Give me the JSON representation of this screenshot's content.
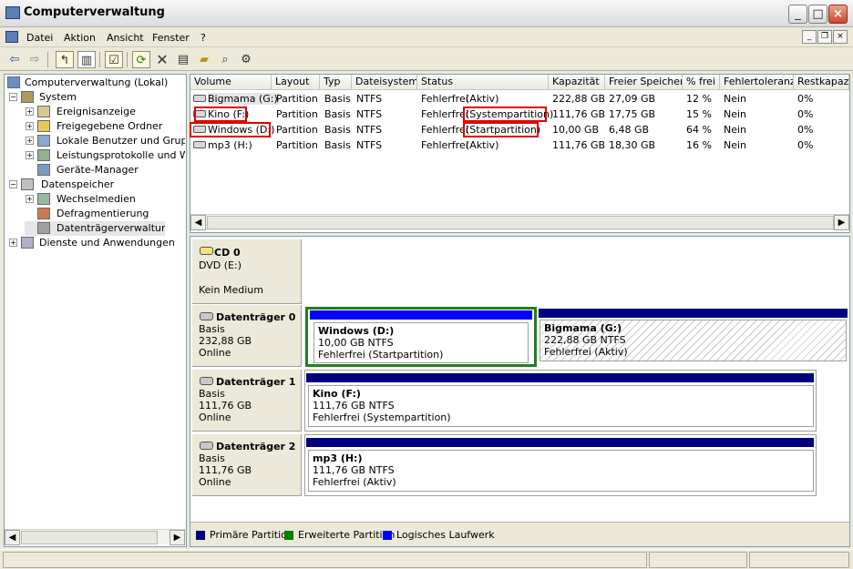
{
  "window": {
    "title": "Computerverwaltung"
  },
  "menu": [
    "Datei",
    "Aktion",
    "Ansicht",
    "Fenster",
    "?"
  ],
  "tree": [
    {
      "label": "Computerverwaltung (Lokal)",
      "exp": "",
      "icon": "computer-icon"
    },
    {
      "label": "System",
      "exp": "−",
      "icon": "system-tools-icon"
    },
    {
      "label": "Ereignisanzeige",
      "exp": "+",
      "icon": "event-viewer-icon"
    },
    {
      "label": "Freigegebene Ordner",
      "exp": "+",
      "icon": "shared-folder-icon"
    },
    {
      "label": "Lokale Benutzer und Gruppen",
      "exp": "+",
      "icon": "users-icon"
    },
    {
      "label": "Leistungsprotokolle und Warnungen",
      "exp": "+",
      "icon": "performance-icon"
    },
    {
      "label": "Geräte-Manager",
      "exp": "",
      "icon": "device-manager-icon"
    },
    {
      "label": "Datenspeicher",
      "exp": "−",
      "icon": "storage-icon"
    },
    {
      "label": "Wechselmedien",
      "exp": "+",
      "icon": "removable-media-icon"
    },
    {
      "label": "Defragmentierung",
      "exp": "",
      "icon": "defrag-icon"
    },
    {
      "label": "Datenträgerverwaltung",
      "exp": "",
      "icon": "disk-management-icon"
    },
    {
      "label": "Dienste und Anwendungen",
      "exp": "+",
      "icon": "services-icon"
    }
  ],
  "columns": [
    "Volume",
    "Layout",
    "Typ",
    "Dateisystem",
    "Status",
    "Kapazität",
    "Freier Speicher",
    "% frei",
    "Fehlertoleranz",
    "Restkapazität"
  ],
  "volumes": [
    {
      "volume": "Bigmama (G:)",
      "layout": "Partition",
      "typ": "Basis",
      "fs": "NTFS",
      "status_a": "Fehlerfrei",
      "status_b": "(Aktiv)",
      "kap": "222,88 GB",
      "frei": "27,09 GB",
      "pct": "12 %",
      "ft": "Nein",
      "rest": "0%"
    },
    {
      "volume": "Kino (F:)",
      "layout": "Partition",
      "typ": "Basis",
      "fs": "NTFS",
      "status_a": "Fehlerfrei",
      "status_b": "(Systempartition)",
      "kap": "111,76 GB",
      "frei": "17,75 GB",
      "pct": "15 %",
      "ft": "Nein",
      "rest": "0%"
    },
    {
      "volume": "Windows (D:)",
      "layout": "Partition",
      "typ": "Basis",
      "fs": "NTFS",
      "status_a": "Fehlerfrei",
      "status_b": "(Startpartition)",
      "kap": "10,00 GB",
      "frei": "6,48 GB",
      "pct": "64 %",
      "ft": "Nein",
      "rest": "0%"
    },
    {
      "volume": "mp3 (H:)",
      "layout": "Partition",
      "typ": "Basis",
      "fs": "NTFS",
      "status_a": "Fehlerfrei",
      "status_b": "(Aktiv)",
      "kap": "111,76 GB",
      "frei": "18,30 GB",
      "pct": "16 %",
      "ft": "Nein",
      "rest": "0%"
    }
  ],
  "disks": {
    "cd0": {
      "name": "CD 0",
      "line1": "DVD (E:)",
      "line2": "Kein Medium"
    },
    "d0": {
      "name": "Datenträger 0",
      "type": "Basis",
      "size": "232,88 GB",
      "state": "Online",
      "p1": {
        "name": "Windows  (D:)",
        "size": "10,00 GB NTFS",
        "status": "Fehlerfrei (Startpartition)"
      },
      "p2": {
        "name": "Bigmama  (G:)",
        "size": "222,88 GB NTFS",
        "status": "Fehlerfrei (Aktiv)"
      }
    },
    "d1": {
      "name": "Datenträger 1",
      "type": "Basis",
      "size": "111,76 GB",
      "state": "Online",
      "p1": {
        "name": "Kino  (F:)",
        "size": "111,76 GB NTFS",
        "status": "Fehlerfrei (Systempartition)"
      }
    },
    "d2": {
      "name": "Datenträger 2",
      "type": "Basis",
      "size": "111,76 GB",
      "state": "Online",
      "p1": {
        "name": "mp3  (H:)",
        "size": "111,76 GB NTFS",
        "status": "Fehlerfrei (Aktiv)"
      }
    }
  },
  "legend": [
    {
      "label": "Primäre Partition",
      "color": "#00007f"
    },
    {
      "label": "Erweiterte Partition",
      "color": "#008000"
    },
    {
      "label": "Logisches Laufwerk",
      "color": "#0000ff"
    }
  ]
}
